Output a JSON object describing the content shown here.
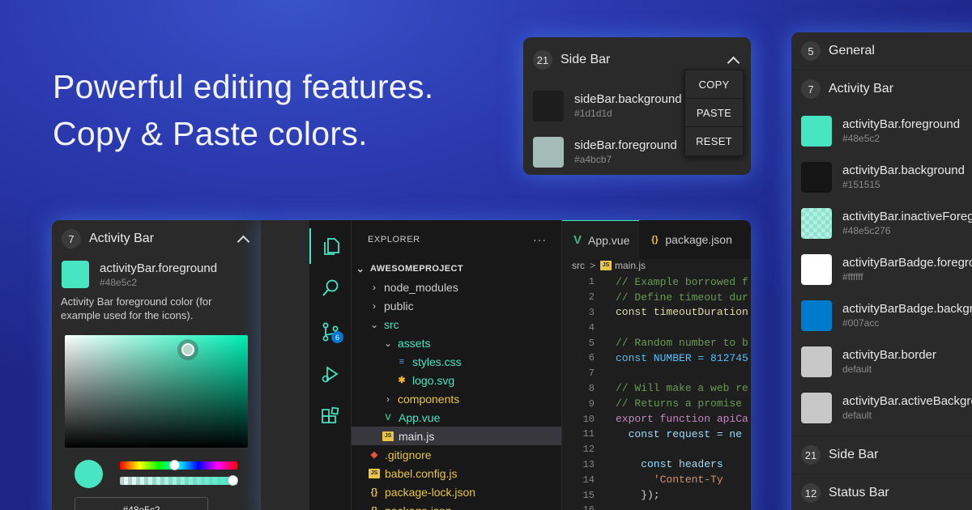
{
  "hero": {
    "line1": "Powerful editing features.",
    "line2": "Copy & Paste colors."
  },
  "sidebar_popup": {
    "number": "21",
    "title": "Side Bar",
    "items": [
      {
        "name": "sideBar.background",
        "value": "#1d1d1d",
        "color": "#1d1d1d"
      },
      {
        "name": "sideBar.foreground",
        "value": "#a4bcb7",
        "color": "#a4bcb7"
      }
    ],
    "context_menu": [
      "COPY",
      "PASTE",
      "RESET"
    ]
  },
  "right_panel": {
    "general": {
      "number": "5",
      "title": "General"
    },
    "activity": {
      "number": "7",
      "title": "Activity Bar"
    },
    "items": [
      {
        "name": "activityBar.foreground",
        "value": "#48e5c2",
        "color": "#48e5c2"
      },
      {
        "name": "activityBar.background",
        "value": "#151515",
        "color": "#151515"
      },
      {
        "name": "activityBar.inactiveForeground",
        "value": "#48e5c276",
        "color": "#48e5c2"
      },
      {
        "name": "activityBarBadge.foreground",
        "value": "#ffffff",
        "color": "#ffffff"
      },
      {
        "name": "activityBarBadge.background",
        "value": "#007acc",
        "color": "#007acc"
      },
      {
        "name": "activityBar.border",
        "value": "default",
        "color": "#c8c8c8"
      },
      {
        "name": "activityBar.activeBackground",
        "value": "default",
        "color": "#c8c8c8"
      }
    ],
    "sidebar": {
      "number": "21",
      "title": "Side Bar"
    },
    "statusbar": {
      "number": "12",
      "title": "Status Bar"
    }
  },
  "editor_panel": {
    "number": "7",
    "title": "Activity Bar",
    "item": {
      "name": "activityBar.foreground",
      "value": "#48e5c2",
      "color": "#48e5c2"
    },
    "description": "Activity Bar foreground color (for example used for the icons).",
    "hex_input": "#48e5c2",
    "hue_level": 0.4,
    "alpha_level": 1.0
  },
  "vscode": {
    "activity_icons": [
      "files-icon",
      "search-icon",
      "source-control-icon",
      "run-debug-icon",
      "extensions-icon"
    ],
    "scm_badge": "6",
    "explorer_title": "EXPLORER",
    "explorer_more": "···",
    "tree": [
      {
        "label": "AWESOMEPROJECT",
        "indent": 0,
        "twisty": "⌄",
        "icon": "",
        "type": "project"
      },
      {
        "label": "node_modules",
        "indent": 1,
        "twisty": "›",
        "icon": "",
        "type": "folder"
      },
      {
        "label": "public",
        "indent": 1,
        "twisty": "›",
        "icon": "",
        "type": "folder"
      },
      {
        "label": "src",
        "indent": 1,
        "twisty": "⌄",
        "icon": "",
        "type": "folder-src"
      },
      {
        "label": "assets",
        "indent": 2,
        "twisty": "⌄",
        "icon": "",
        "type": "folder"
      },
      {
        "label": "styles.css",
        "indent": 3,
        "twisty": "",
        "icon": "css",
        "type": "file"
      },
      {
        "label": "logo.svg",
        "indent": 3,
        "twisty": "",
        "icon": "svg",
        "type": "file"
      },
      {
        "label": "components",
        "indent": 2,
        "twisty": "›",
        "icon": "",
        "type": "folder-comp"
      },
      {
        "label": "App.vue",
        "indent": 2,
        "twisty": "",
        "icon": "vue",
        "type": "file"
      },
      {
        "label": "main.js",
        "indent": 2,
        "twisty": "",
        "icon": "js",
        "type": "file",
        "selected": true
      },
      {
        "label": ".gitignore",
        "indent": 1,
        "twisty": "",
        "icon": "git",
        "type": "file"
      },
      {
        "label": "babel.config.js",
        "indent": 1,
        "twisty": "",
        "icon": "js",
        "type": "file"
      },
      {
        "label": "package-lock.json",
        "indent": 1,
        "twisty": "",
        "icon": "json",
        "type": "file"
      },
      {
        "label": "package.json",
        "indent": 1,
        "twisty": "",
        "icon": "json",
        "type": "file"
      }
    ],
    "tabs": [
      {
        "label": "App.vue",
        "icon": "vue",
        "active": true
      },
      {
        "label": "package.json",
        "icon": "json",
        "active": false
      }
    ],
    "breadcrumb": {
      "folder": "src",
      "sep": ">",
      "file": "main.js"
    },
    "code_lines": [
      {
        "n": "1",
        "text": "// Example borrowed f",
        "kind": "comment"
      },
      {
        "n": "2",
        "text": "// Define timeout dur",
        "kind": "comment"
      },
      {
        "n": "3",
        "text": "const timeoutDuration",
        "kind": "decl"
      },
      {
        "n": "4",
        "text": "",
        "kind": "plain"
      },
      {
        "n": "5",
        "text": "// Random number to b",
        "kind": "comment"
      },
      {
        "n": "6",
        "text": "const NUMBER = 812745",
        "kind": "decl-const"
      },
      {
        "n": "7",
        "text": "",
        "kind": "plain"
      },
      {
        "n": "8",
        "text": "// Will make a web re",
        "kind": "comment"
      },
      {
        "n": "9",
        "text": "// Returns a promise ",
        "kind": "comment"
      },
      {
        "n": "10",
        "text": "export function apiCa",
        "kind": "export"
      },
      {
        "n": "11",
        "text": "  const request = ne",
        "kind": "decl-inner"
      },
      {
        "n": "12",
        "text": "",
        "kind": "plain"
      },
      {
        "n": "13",
        "text": "    const headers ",
        "kind": "decl-inner2"
      },
      {
        "n": "14",
        "text": "      'Content-Ty",
        "kind": "string"
      },
      {
        "n": "15",
        "text": "    });",
        "kind": "plain"
      },
      {
        "n": "16",
        "text": "",
        "kind": "plain"
      }
    ]
  }
}
